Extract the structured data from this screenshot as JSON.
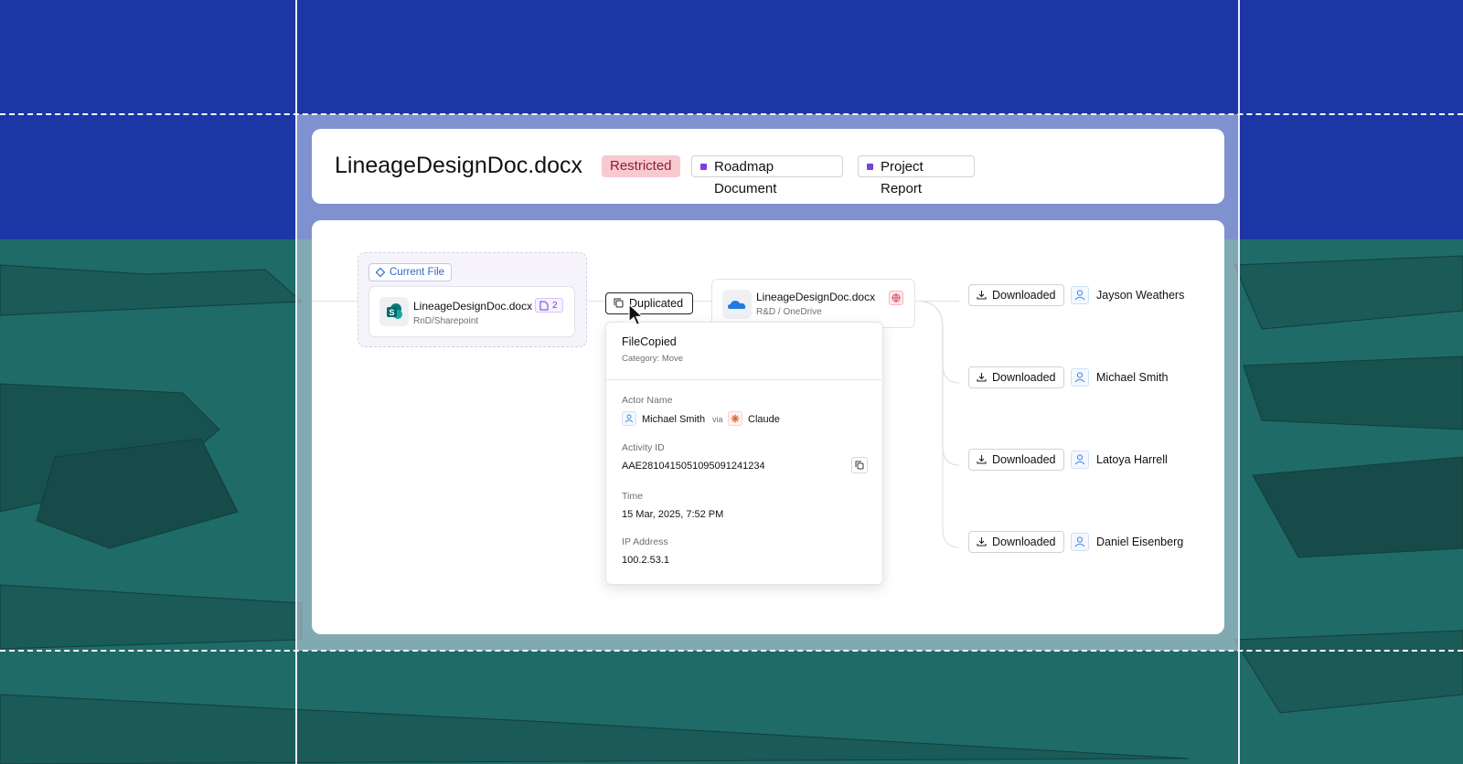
{
  "header": {
    "title": "LineageDesignDoc.docx",
    "tags": [
      {
        "label": "Restricted",
        "color": "#f9c9d0"
      },
      {
        "label": "Roadmap Document",
        "color": "#7a3fe0"
      },
      {
        "label": "Project Report",
        "color": "#7a3fe0"
      }
    ]
  },
  "lineage": {
    "current_label": "Current File",
    "current_file": {
      "name": "LineageDesignDoc.docx",
      "location": "RnD/Sharepoint",
      "versions": "2",
      "icon": "sharepoint-icon"
    },
    "action": {
      "label": "Duplicated",
      "icon": "copy-icon"
    },
    "copy_file": {
      "name": "LineageDesignDoc.docx",
      "location": "R&D / OneDrive",
      "icon": "onedrive-icon"
    },
    "downloads": [
      {
        "label": "Downloaded",
        "user": "Jayson Weathers"
      },
      {
        "label": "Downloaded",
        "user": "Michael Smith"
      },
      {
        "label": "Downloaded",
        "user": "Latoya Harrell"
      },
      {
        "label": "Downloaded",
        "user": "Daniel Eisenberg"
      }
    ]
  },
  "details": {
    "event": "FileCopied",
    "category": "Category: Move",
    "actor_label": "Actor Name",
    "actor": "Michael Smith",
    "via": "via",
    "agent": "Claude",
    "activity_label": "Activity ID",
    "activity_id": "AAE28104150510950912412​34",
    "time_label": "Time",
    "time": "15 Mar, 2025, 7:52 PM",
    "ip_label": "IP Address",
    "ip": "100.2.53.1"
  },
  "colors": {
    "sky": "#1c36a6",
    "sea": "#1f6b67",
    "accent": "#7a3fe0"
  }
}
